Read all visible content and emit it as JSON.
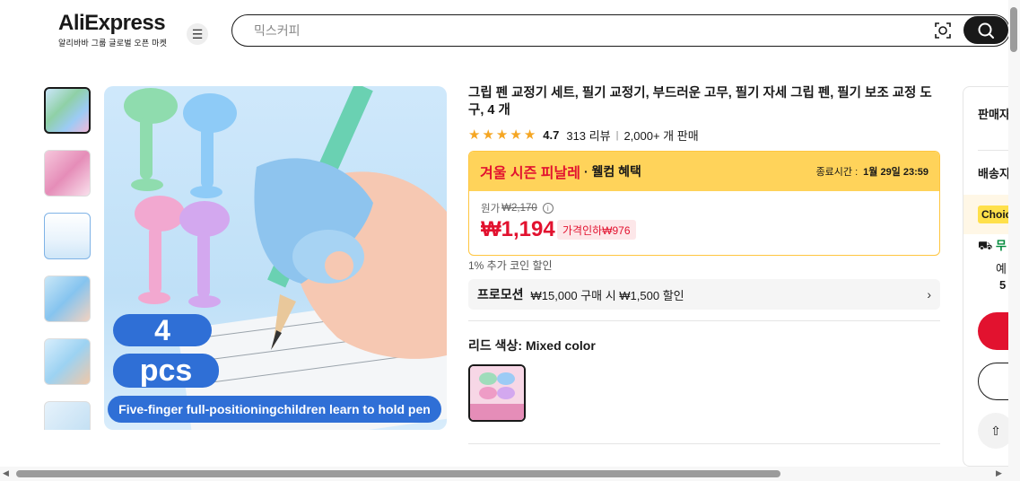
{
  "header": {
    "logo": "AliExpress",
    "logo_sub": "알리바바 그룹 글로벌 오픈 마켓",
    "search_placeholder": "믹스커피",
    "icons": [
      "menu-icon",
      "camera-search-icon",
      "search-icon"
    ]
  },
  "gallery": {
    "thumbnail_count": 6,
    "main_image_text": {
      "count": "4",
      "unit": "pcs",
      "caption": "Five-finger full-positioningchildren learn to hold pen"
    }
  },
  "product": {
    "title": "그립 펜 교정기 세트, 필기 교정기, 부드러운 고무, 필기 자세 그립 펜, 필기 보조 교정 도구, 4 개",
    "rating": "4.7",
    "reviews": "313 리뷰",
    "sold": "2,000+ 개 판매",
    "sale": {
      "title": "겨울 시즌 피날레",
      "subtitle": "· 웰컴 혜택",
      "end_label": "종료시간 :",
      "end_time": "1월 29일 23:59"
    },
    "original_label": "원가",
    "original_price": "₩2,170",
    "price": "₩1,194",
    "discount": "가격인하₩976",
    "coin_text": "1% 추가 코인 할인",
    "promo": {
      "label": "프로모션",
      "text": "₩15,000 구매 시 ₩1,500 할인"
    },
    "color": {
      "label": "리드 색상:",
      "value": "Mixed color"
    }
  },
  "right_panel": {
    "seller_label": "판매자",
    "shipping_label": "배송지",
    "choice_badge": "Choic",
    "free_label": "무",
    "text1": "예",
    "text2": "5"
  },
  "colors": {
    "accent_red": "#e2122f",
    "sale_yellow": "#ffd35a",
    "star": "#f5a623"
  }
}
